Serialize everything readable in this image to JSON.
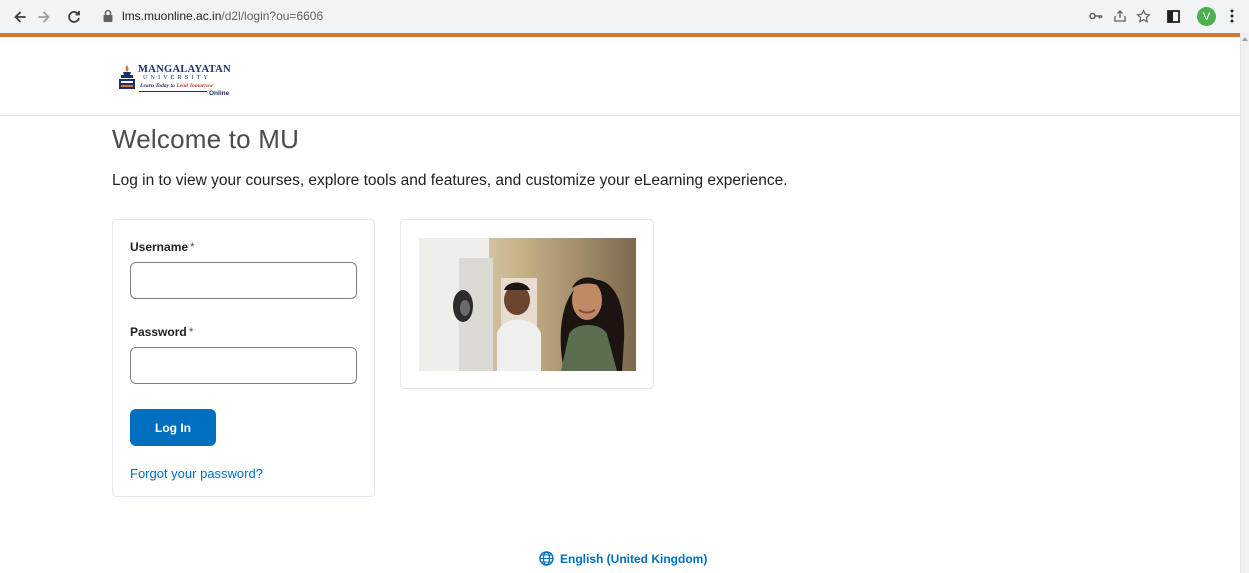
{
  "browser": {
    "url_host": "lms.muonline.ac.in",
    "url_path": "/d2l/login?ou=6606",
    "profile_initial": "V"
  },
  "header": {
    "logo_name": "MANGALAYATAN",
    "logo_university": "UNIVERSITY",
    "logo_tagline_1": "Learn Today to ",
    "logo_tagline_2": "Lead Tomorrow",
    "logo_online": "Online"
  },
  "main": {
    "title": "Welcome to MU",
    "intro": "Log in to view your courses, explore tools and features, and customize your eLearning experience."
  },
  "login_form": {
    "username_label": "Username",
    "password_label": "Password",
    "required_marker": "*",
    "username_value": "",
    "password_value": "",
    "login_button": "Log In",
    "forgot_link": "Forgot your password?"
  },
  "footer": {
    "language": "English (United Kingdom)"
  },
  "colors": {
    "accent": "#006fbf",
    "brand_strip": "#d3782c",
    "title_text": "#494c4e"
  }
}
